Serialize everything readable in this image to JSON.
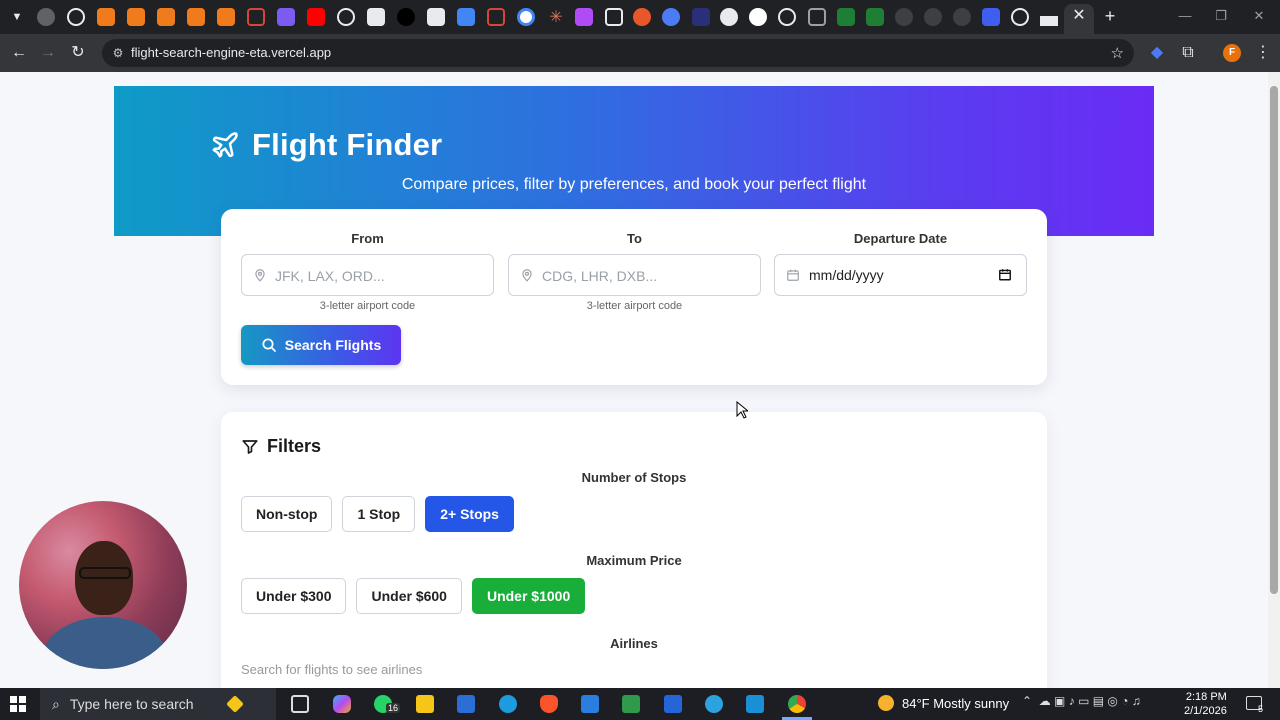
{
  "browser": {
    "url": "flight-search-engine-eta.vercel.app"
  },
  "hero": {
    "title": "Flight Finder",
    "subtitle": "Compare prices, filter by preferences, and book your perfect flight"
  },
  "search": {
    "from_label": "From",
    "from_placeholder": "JFK, LAX, ORD...",
    "from_hint": "3-letter airport code",
    "to_label": "To",
    "to_placeholder": "CDG, LHR, DXB...",
    "to_hint": "3-letter airport code",
    "date_label": "Departure Date",
    "date_value": "mm/dd/yyyy",
    "button_label": "Search Flights"
  },
  "filters": {
    "title": "Filters",
    "stops_label": "Number of Stops",
    "stops": [
      "Non-stop",
      "1 Stop",
      "2+ Stops"
    ],
    "stops_selected": "2+ Stops",
    "price_label": "Maximum Price",
    "prices": [
      "Under $300",
      "Under $600",
      "Under $1000"
    ],
    "price_selected": "Under $1000",
    "airlines_label": "Airlines",
    "airlines_hint": "Search for flights to see airlines"
  },
  "taskbar": {
    "search_placeholder": "Type here to search",
    "whatsapp_badge": "16",
    "weather": "84°F  Mostly sunny",
    "time": "2:18 PM",
    "date": "2/1/2026",
    "notification_count": "5"
  },
  "colors": {
    "hero_gradient_start": "#0e9bc7",
    "hero_gradient_end": "#6a2cf5",
    "stops_active": "#2456e8",
    "price_active": "#19ae3a"
  }
}
